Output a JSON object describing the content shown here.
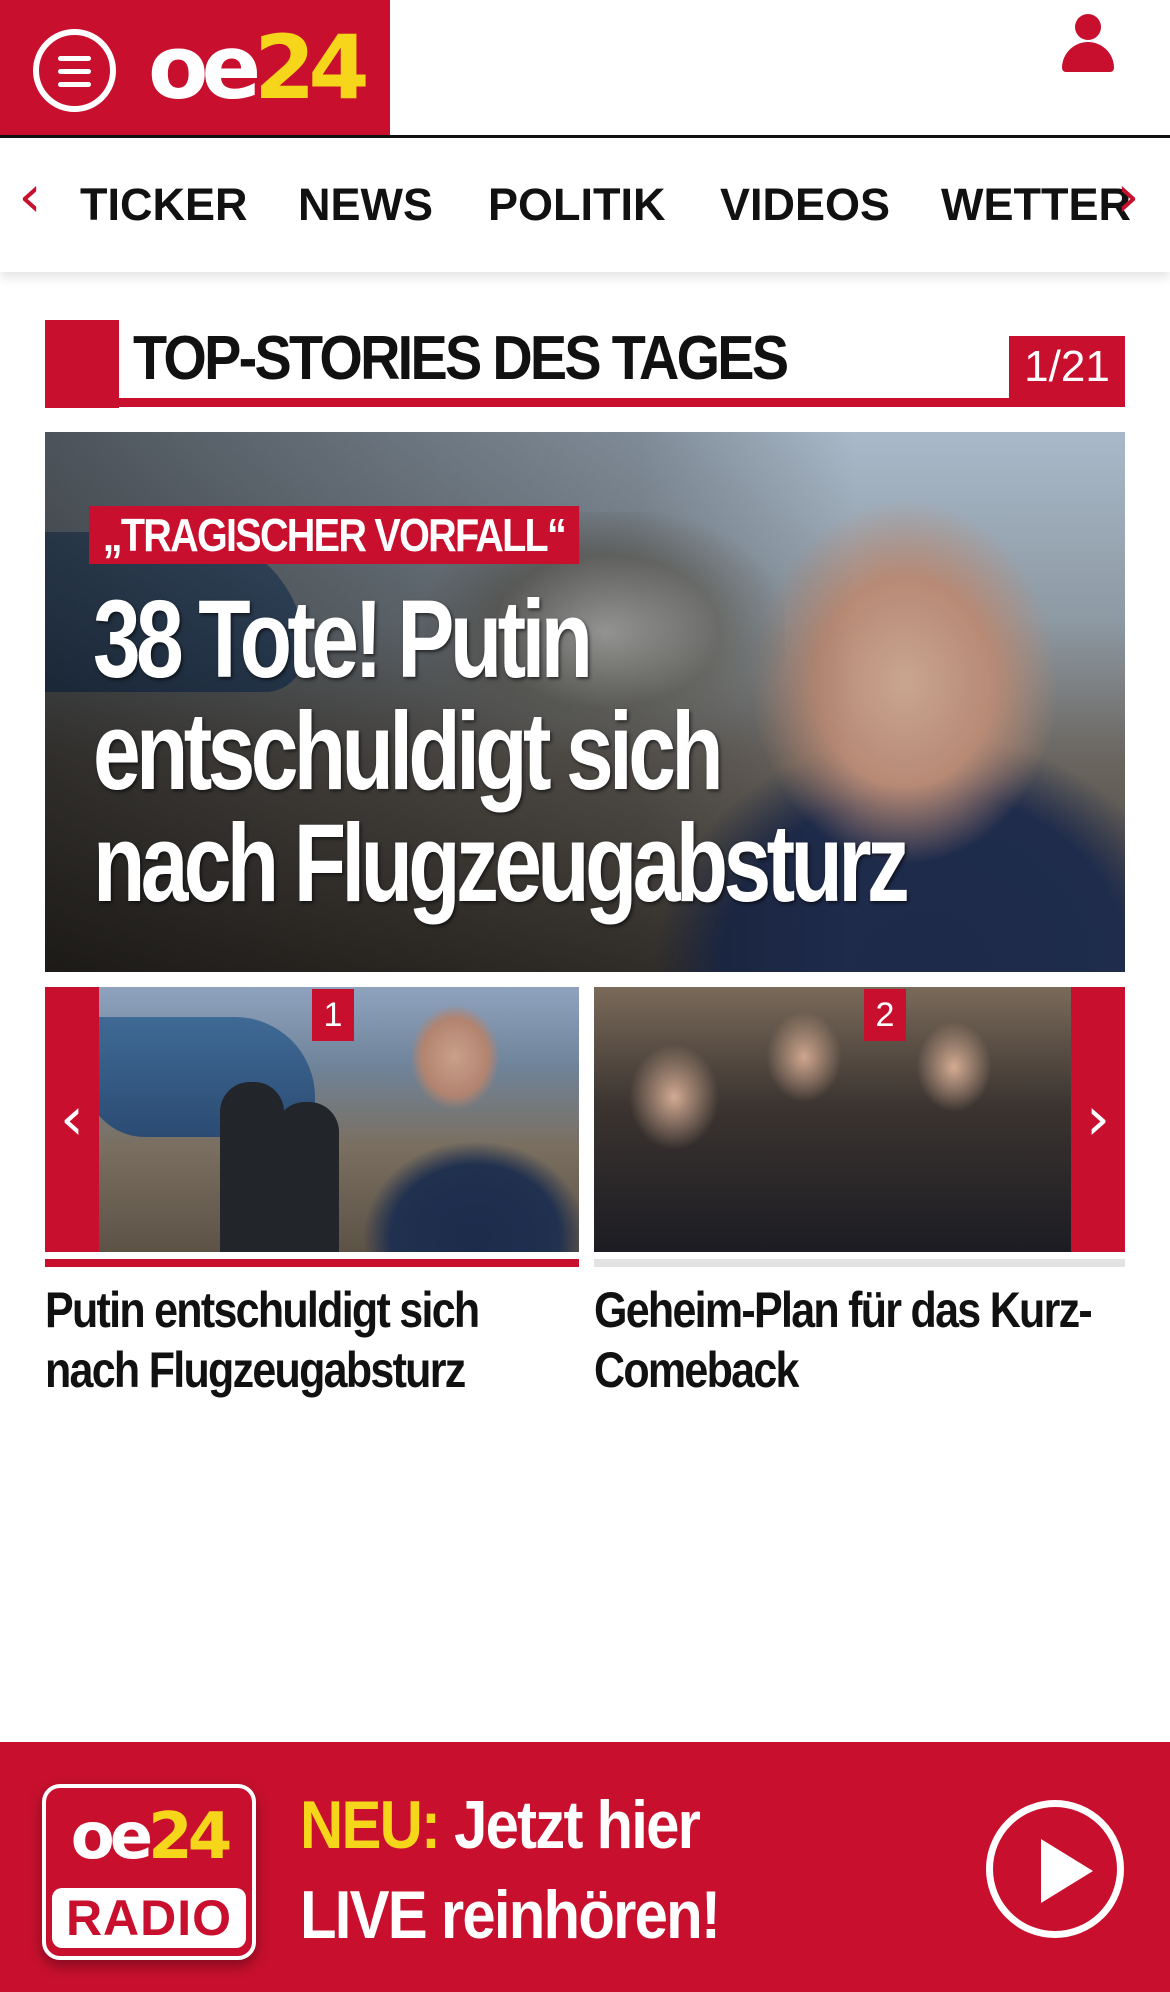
{
  "header": {
    "logo_oe": "oe",
    "logo_num": "24",
    "menu_icon": "hamburger-menu-icon",
    "user_icon": "user-icon"
  },
  "nav": {
    "prev_arrow": "‹",
    "next_arrow": "›",
    "items": [
      "TICKER",
      "NEWS",
      "POLITIK",
      "VIDEOS",
      "WETTER"
    ]
  },
  "section": {
    "title": "TOP-STORIES DES TAGES",
    "counter": "1/21"
  },
  "hero": {
    "kicker": "„TRAGISCHER VORFALL“",
    "title_line1": "38 Tote! Putin",
    "title_line2": "entschuldigt sich",
    "title_line3": "nach Flugzeugabsturz"
  },
  "carousel": {
    "prev": "‹",
    "next": "›",
    "items": [
      {
        "badge": "1",
        "title": "Putin entschuldigt sich nach Flugzeugabsturz"
      },
      {
        "badge": "2",
        "title": "Geheim-Plan für das Kurz-Comeback"
      }
    ],
    "active_index": 1
  },
  "radio": {
    "logo_oe": "oe",
    "logo_num": "24",
    "logo_label": "RADIO",
    "neu": "NEU:",
    "line1_rest": " Jetzt hier",
    "line2": "LIVE reinhören!",
    "play_icon": "play-icon"
  },
  "colors": {
    "brand_red": "#c8102e",
    "brand_yellow": "#f5d61b"
  }
}
